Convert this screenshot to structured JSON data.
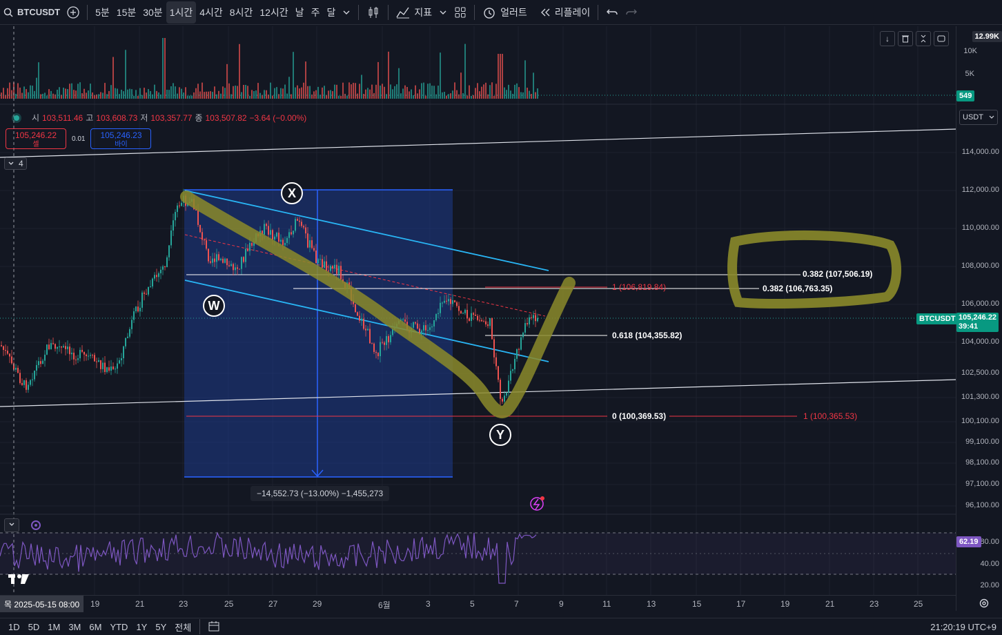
{
  "toolbar": {
    "symbol": "BTCUSDT",
    "timeframes": [
      {
        "label": "5분",
        "active": false
      },
      {
        "label": "15분",
        "active": false
      },
      {
        "label": "30분",
        "active": false
      },
      {
        "label": "1시간",
        "active": true
      },
      {
        "label": "4시간",
        "active": false
      },
      {
        "label": "8시간",
        "active": false
      },
      {
        "label": "12시간",
        "active": false
      },
      {
        "label": "날",
        "active": false
      },
      {
        "label": "주",
        "active": false
      },
      {
        "label": "달",
        "active": false
      }
    ],
    "indicators_label": "지표",
    "alert_label": "얼러트",
    "replay_label": "리플레이"
  },
  "ohlc": {
    "open_label": "시",
    "open": "103,511.46",
    "high_label": "고",
    "high": "103,608.73",
    "low_label": "저",
    "low": "103,357.77",
    "close_label": "종",
    "close": "103,507.82",
    "change": "−3.64 (−0.00%)"
  },
  "trade": {
    "sell_price": "105,246.22",
    "sell_label": "셀",
    "spread": "0.01",
    "buy_price": "105,246.23",
    "buy_label": "바이"
  },
  "legend_count": "4",
  "currency": "USDT",
  "volume_axis": {
    "top": "12.99K",
    "mid1": "10K",
    "mid2": "5K",
    "current": "549"
  },
  "price_axis": [
    "114,000.00",
    "112,000.00",
    "110,000.00",
    "108,000.00",
    "106,000.00",
    "104,000.00",
    "102,500.00",
    "101,300.00",
    "100,100.00",
    "99,100.00",
    "98,100.00",
    "97,100.00",
    "96,100.00"
  ],
  "current_price": {
    "symbol": "BTCUSDT",
    "price": "105,246.22",
    "countdown": "39:41"
  },
  "rsi_axis": {
    "top": "80.00",
    "mid": "40.00",
    "low": "20.00",
    "current": "62.19"
  },
  "fib_labels": {
    "l1": "0.382 (107,506.19)",
    "l2": "0.382 (106,763.35)",
    "l3": "1 (106,819.84)",
    "l4": "0.618 (104,355.82)",
    "l5": "0 (100,369.53)",
    "l6": "1 (100,365.53)"
  },
  "wave_labels": {
    "w": "W",
    "x": "X",
    "y": "Y"
  },
  "measure": "−14,552.73 (−13.00%) −1,455,273",
  "time_axis": {
    "crosshair": "목 2025-05-15   08:00",
    "ticks": [
      "19",
      "21",
      "23",
      "25",
      "27",
      "29",
      "6월",
      "3",
      "5",
      "7",
      "9",
      "11",
      "13",
      "15",
      "17",
      "19",
      "21",
      "23",
      "25"
    ]
  },
  "bottom": {
    "ranges": [
      "1D",
      "5D",
      "1M",
      "3M",
      "6M",
      "YTD",
      "1Y",
      "5Y",
      "전체"
    ],
    "clock": "21:20:19 UTC+9"
  },
  "colors": {
    "bg": "#131722",
    "up": "#26a69a",
    "down": "#ef5350",
    "rsi": "#7e57c2",
    "highlight": "#8b8a2a",
    "channel": "#29b6f6"
  }
}
